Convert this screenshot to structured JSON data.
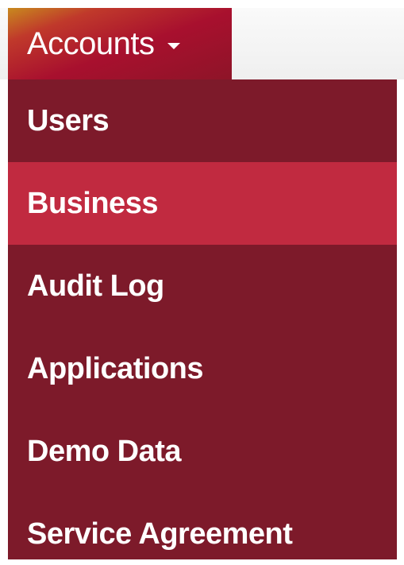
{
  "nav": {
    "tab_label": "Accounts",
    "tab_icon": "caret-down-icon"
  },
  "menu": {
    "items": [
      {
        "label": "Users",
        "active": false
      },
      {
        "label": "Business",
        "active": true
      },
      {
        "label": "Audit Log",
        "active": false
      },
      {
        "label": "Applications",
        "active": false
      },
      {
        "label": "Demo Data",
        "active": false
      },
      {
        "label": "Service Agreement",
        "active": false
      }
    ]
  },
  "colors": {
    "menu_background": "#7d1a2a",
    "active_item": "#c12a40",
    "text": "#ffffff"
  }
}
